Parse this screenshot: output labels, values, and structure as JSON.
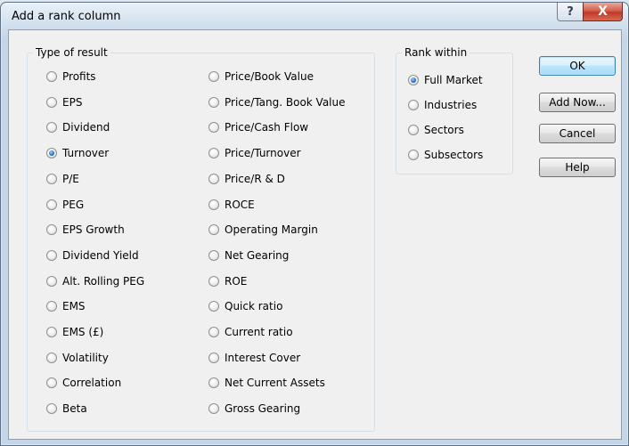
{
  "dialog": {
    "title": "Add a rank column",
    "help_glyph": "?",
    "close_glyph": "X"
  },
  "type_of_result": {
    "legend": "Type of result",
    "left_column": [
      {
        "label": "Profits",
        "checked": false
      },
      {
        "label": "EPS",
        "checked": false
      },
      {
        "label": "Dividend",
        "checked": false
      },
      {
        "label": "Turnover",
        "checked": true
      },
      {
        "label": "P/E",
        "checked": false
      },
      {
        "label": "PEG",
        "checked": false
      },
      {
        "label": "EPS Growth",
        "checked": false
      },
      {
        "label": "Dividend Yield",
        "checked": false
      },
      {
        "label": "Alt. Rolling PEG",
        "checked": false
      },
      {
        "label": "EMS",
        "checked": false
      },
      {
        "label": "EMS (£)",
        "checked": false
      },
      {
        "label": "Volatility",
        "checked": false
      },
      {
        "label": "Correlation",
        "checked": false
      },
      {
        "label": "Beta",
        "checked": false
      }
    ],
    "right_column": [
      {
        "label": "Price/Book Value",
        "checked": false
      },
      {
        "label": "Price/Tang. Book Value",
        "checked": false
      },
      {
        "label": "Price/Cash Flow",
        "checked": false
      },
      {
        "label": "Price/Turnover",
        "checked": false
      },
      {
        "label": "Price/R & D",
        "checked": false
      },
      {
        "label": "ROCE",
        "checked": false
      },
      {
        "label": "Operating Margin",
        "checked": false
      },
      {
        "label": "Net Gearing",
        "checked": false
      },
      {
        "label": "ROE",
        "checked": false
      },
      {
        "label": "Quick ratio",
        "checked": false
      },
      {
        "label": "Current ratio",
        "checked": false
      },
      {
        "label": "Interest Cover",
        "checked": false
      },
      {
        "label": "Net Current Assets",
        "checked": false
      },
      {
        "label": "Gross Gearing",
        "checked": false
      }
    ]
  },
  "rank_within": {
    "legend": "Rank within",
    "options": [
      {
        "label": "Full Market",
        "checked": true
      },
      {
        "label": "Industries",
        "checked": false
      },
      {
        "label": "Sectors",
        "checked": false
      },
      {
        "label": "Subsectors",
        "checked": false
      }
    ]
  },
  "buttons": {
    "ok": "OK",
    "add_now": "Add Now...",
    "cancel": "Cancel",
    "help": "Help"
  }
}
